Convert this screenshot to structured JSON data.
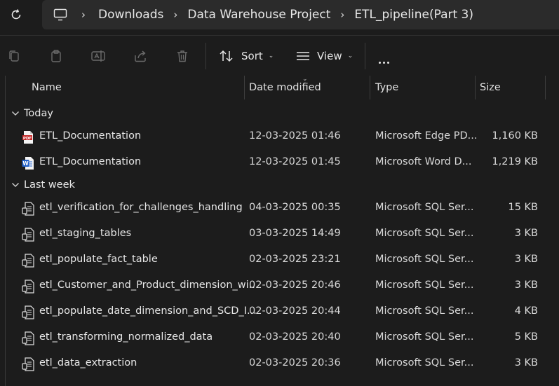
{
  "breadcrumb": {
    "items": [
      "Downloads",
      "Data Warehouse Project",
      "ETL_pipeline(Part 3)"
    ]
  },
  "toolbar": {
    "sort_label": "Sort",
    "view_label": "View"
  },
  "columns": {
    "name": "Name",
    "date": "Date modified",
    "type": "Type",
    "size": "Size"
  },
  "groups": {
    "today": "Today",
    "last_week": "Last week"
  },
  "files_today": [
    {
      "name": "ETL_Documentation",
      "date": "12-03-2025 01:46",
      "type": "Microsoft Edge PD...",
      "size": "1,160 KB",
      "icon": "pdf-file-icon"
    },
    {
      "name": "ETL_Documentation",
      "date": "12-03-2025 01:45",
      "type": "Microsoft Word D...",
      "size": "1,219 KB",
      "icon": "word-file-icon"
    }
  ],
  "files_last_week": [
    {
      "name": "etl_verification_for_challenges_handling",
      "date": "04-03-2025 00:35",
      "type": "Microsoft SQL Ser...",
      "size": "15 KB",
      "icon": "sql-file-icon"
    },
    {
      "name": "etl_staging_tables",
      "date": "03-03-2025 14:49",
      "type": "Microsoft SQL Ser...",
      "size": "3 KB",
      "icon": "sql-file-icon"
    },
    {
      "name": "etl_populate_fact_table",
      "date": "02-03-2025 23:21",
      "type": "Microsoft SQL Ser...",
      "size": "3 KB",
      "icon": "sql-file-icon"
    },
    {
      "name": "etl_Customer_and_Product_dimension_wi...",
      "date": "02-03-2025 20:46",
      "type": "Microsoft SQL Ser...",
      "size": "3 KB",
      "icon": "sql-file-icon"
    },
    {
      "name": "etl_populate_date_dimension_and_SCD_I...",
      "date": "02-03-2025 20:44",
      "type": "Microsoft SQL Ser...",
      "size": "4 KB",
      "icon": "sql-file-icon"
    },
    {
      "name": "etl_transforming_normalized_data",
      "date": "02-03-2025 20:40",
      "type": "Microsoft SQL Ser...",
      "size": "5 KB",
      "icon": "sql-file-icon"
    },
    {
      "name": "etl_data_extraction",
      "date": "02-03-2025 20:36",
      "type": "Microsoft SQL Ser...",
      "size": "3 KB",
      "icon": "sql-file-icon"
    }
  ]
}
